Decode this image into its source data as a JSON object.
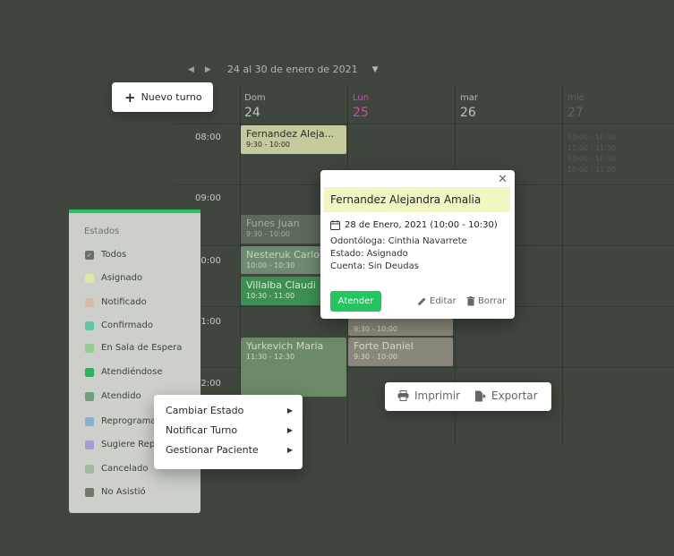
{
  "calendar": {
    "range": "24 al 30 de enero de 2021",
    "days": [
      {
        "name": "Dom",
        "num": "24"
      },
      {
        "name": "Lun",
        "num": "25"
      },
      {
        "name": "mar",
        "num": "26"
      },
      {
        "name": "mié",
        "num": "27"
      }
    ],
    "times": [
      "08:00",
      "09:00",
      "10:00",
      "11:00",
      "12:00"
    ],
    "events": [
      {
        "name": "Fernandez Aleja...",
        "time": "9:30 - 10:00",
        "color": "#c6c99c"
      },
      {
        "name": "Funes Juan",
        "time": "9:30 - 10:00",
        "color": "#5f685c"
      },
      {
        "name": "Nesteruk Carlo",
        "time": "10:00 - 10:30",
        "color": "#6e8a72"
      },
      {
        "name": "Villalba Claudi",
        "time": "10:30 - 11:00",
        "color": "#3f8f55"
      },
      {
        "name": "Yurkevich Maria",
        "time": "11:30 - 12:30",
        "color": "#6c8a67"
      },
      {
        "name": "",
        "time": "9:30 - 10:00",
        "color": "#8a8679"
      },
      {
        "name": "Forte Daniel",
        "time": "9:30 - 10:00",
        "color": "#8a8679"
      }
    ],
    "faded": [
      "10:00 - 10:30",
      "11:00 - 11:30",
      "10:00 - 10:30",
      "10:00 - 11:00"
    ]
  },
  "new_button": {
    "label": "Nuevo turno"
  },
  "estados": {
    "title": "Estados",
    "items": [
      {
        "label": "Todos",
        "color": "#6b6f69",
        "checked": true
      },
      {
        "label": "Asignado",
        "color": "#e0e6a6"
      },
      {
        "label": "Notificado",
        "color": "#d8bba4"
      },
      {
        "label": "Confirmado",
        "color": "#5cc8a6"
      },
      {
        "label": "En Sala de Espera",
        "color": "#95cf8f"
      },
      {
        "label": "Atendiéndose",
        "color": "#2ab25a"
      },
      {
        "label": "Atendido",
        "color": "#6e9e7e"
      },
      {
        "label": "Reprogramado",
        "color": "#88aed0"
      },
      {
        "label": "Sugiere Reprogramación",
        "color": "#a99ad3"
      },
      {
        "label": "Cancelado",
        "color": "#9fb8a0"
      },
      {
        "label": "No Asistió",
        "color": "#6e7b6a"
      }
    ]
  },
  "context_menu": {
    "items": [
      "Cambiar Estado",
      "Notificar Turno",
      "Gestionar Paciente"
    ]
  },
  "popover": {
    "name": "Fernandez Alejandra Amalia",
    "date": "28 de Enero, 2021 (10:00 - 10:30)",
    "odontologa": "Odontóloga: Cinthia Navarrete",
    "estado": "Estado: Asignado",
    "cuenta": "Cuenta: Sin Deudas",
    "attend_label": "Atender",
    "edit_label": "Editar",
    "delete_label": "Borrar"
  },
  "toolbar": {
    "print_label": "Imprimir",
    "export_label": "Exportar"
  }
}
